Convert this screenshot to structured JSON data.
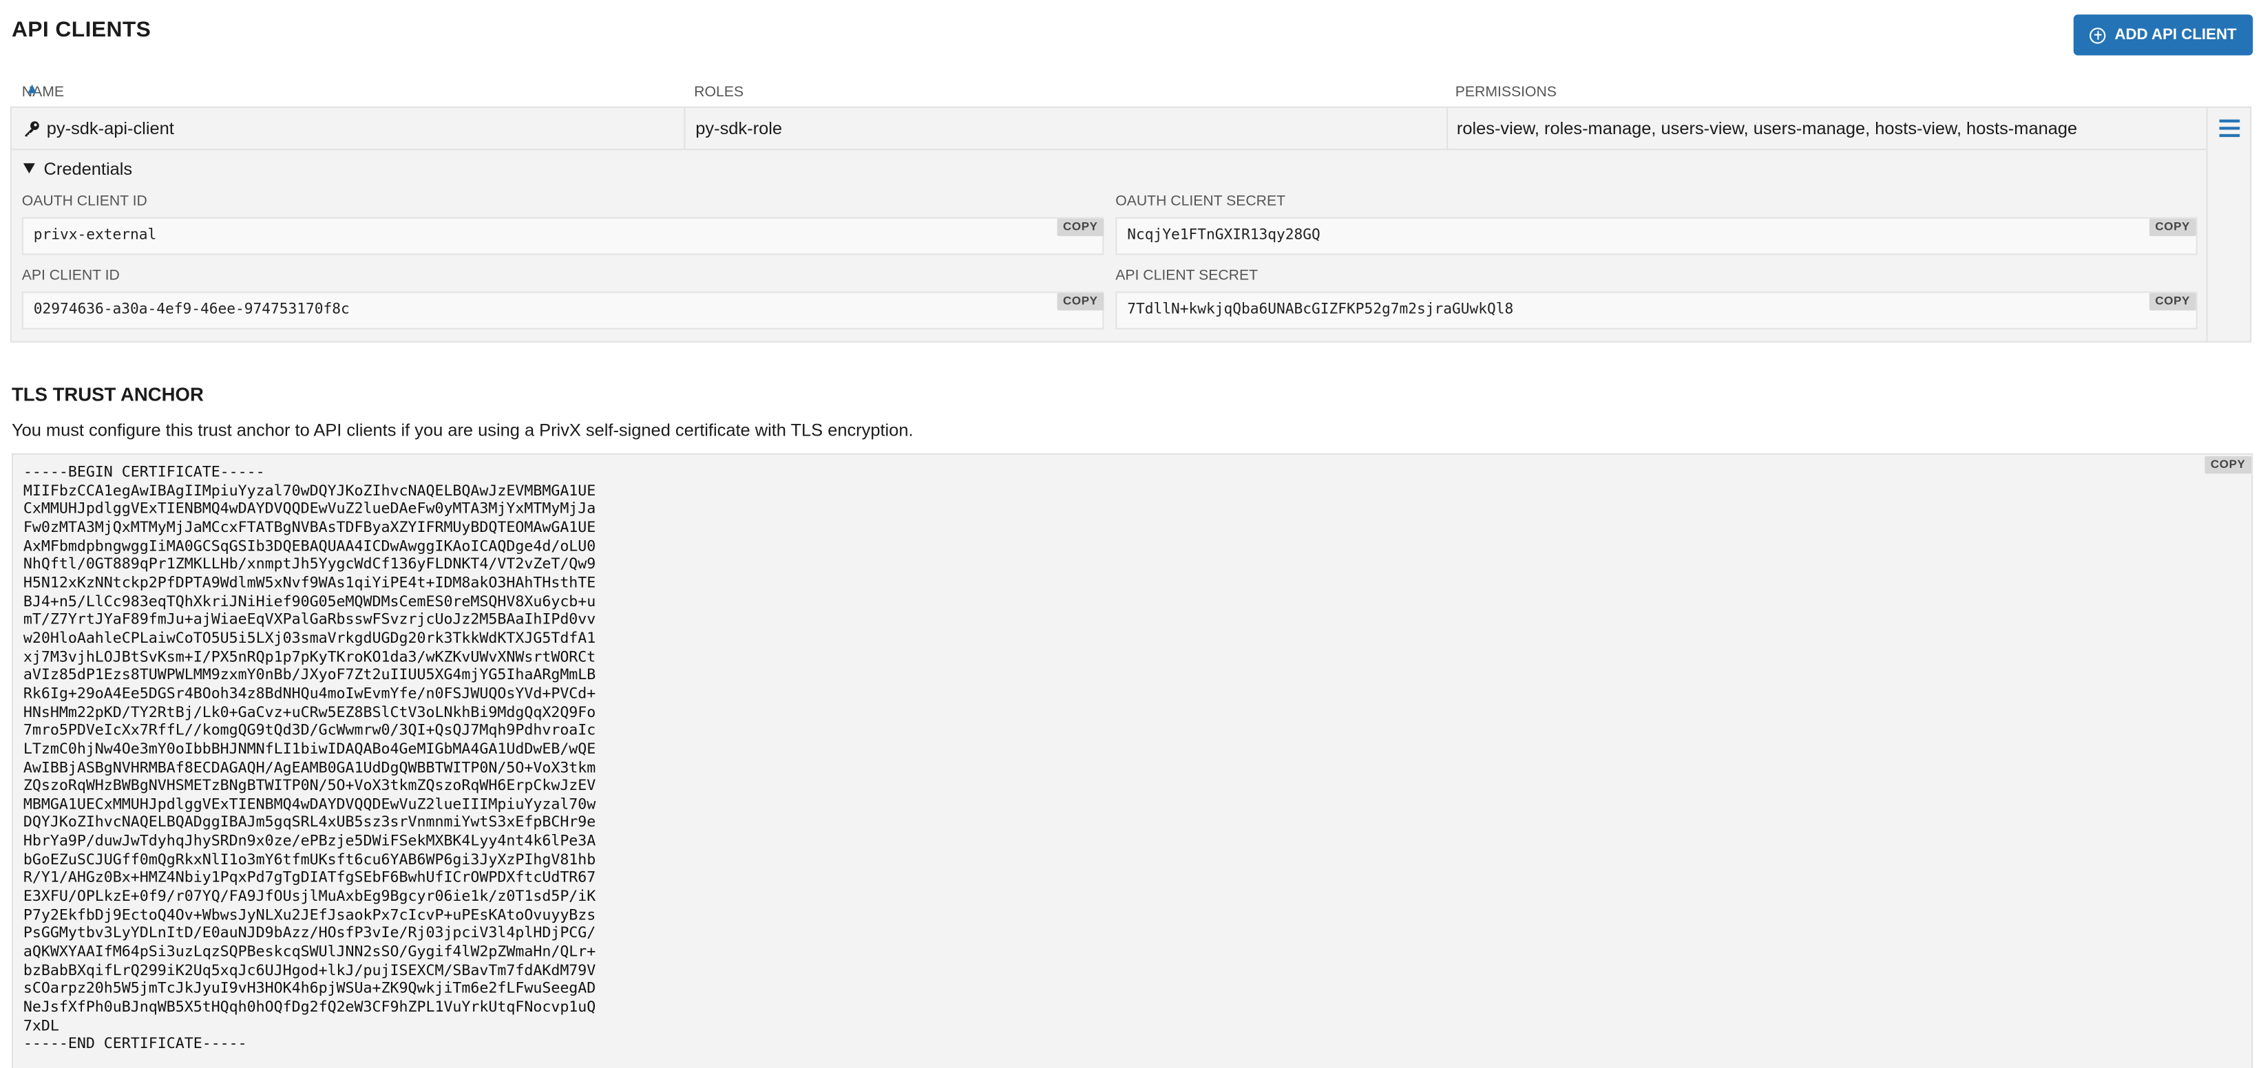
{
  "header": {
    "title": "API CLIENTS",
    "add_button_label": "ADD API CLIENT"
  },
  "table": {
    "columns": [
      "NAME",
      "ROLES",
      "PERMISSIONS"
    ],
    "rows": [
      {
        "name": "py-sdk-api-client",
        "roles": "py-sdk-role",
        "permissions": "roles-view, roles-manage, users-view, users-manage, hosts-view, hosts-manage"
      }
    ]
  },
  "credentials": {
    "toggle_label": "Credentials",
    "oauth_client_id_label": "OAUTH CLIENT ID",
    "oauth_client_id": "privx-external",
    "oauth_client_secret_label": "OAUTH CLIENT SECRET",
    "oauth_client_secret": "NcqjYe1FTnGXIR13qy28GQ",
    "api_client_id_label": "API CLIENT ID",
    "api_client_id": "02974636-a30a-4ef9-46ee-974753170f8c",
    "api_client_secret_label": "API CLIENT SECRET",
    "api_client_secret": "7TdllN+kwkjqQba6UNABcGIZFKP52g7m2sjraGUwkQl8",
    "copy_label": "COPY"
  },
  "trust_anchor": {
    "title": "TLS TRUST ANCHOR",
    "description": "You must configure this trust anchor to API clients if you are using a PrivX self-signed certificate with TLS encryption.",
    "copy_label": "COPY",
    "certificate": "-----BEGIN CERTIFICATE-----\nMIIFbzCCA1egAwIBAgIIMpiuYyzal70wDQYJKoZIhvcNAQELBQAwJzEVMBMGA1UE\nCxMMUHJpdlggVExTIENBMQ4wDAYDVQQDEwVuZ2lueDAeFw0yMTA3MjYxMTMyMjJa\nFw0zMTA3MjQxMTMyMjJaMCcxFTATBgNVBAsTDFByaXZYIFRMUyBDQTEOMAwGA1UE\nAxMFbmdpbngwggIiMA0GCSqGSIb3DQEBAQUAA4ICDwAwggIKAoICAQDge4d/oLU0\nNhQftl/0GT889qPr1ZMKLLHb/xnmptJh5YygcWdCf136yFLDNKT4/VT2vZeT/Qw9\nH5N12xKzNNtckp2PfDPTA9WdlmW5xNvf9WAs1qiYiPE4t+IDM8akO3HAhTHsthTE\nBJ4+n5/LlCc983eqTQhXkriJNiHief90G05eMQWDMsCemES0reMSQHV8Xu6ycb+u\nmT/Z7YrtJYaF89fmJu+ajWiaeEqVXPalGaRbsswFSvzrjcUoJz2M5BAaIhIPd0vv\nw20HloAahleCPLaiwCoTO5U5i5LXj03smaVrkgdUGDg20rk3TkkWdKTXJG5TdfA1\nxj7M3vjhLOJBtSvKsm+I/PX5nRQp1p7pKyTKroKO1da3/wKZKvUWvXNWsrtWORCt\naVIz85dP1Ezs8TUWPWLMM9zxmY0nBb/JXyoF7Zt2uIIUU5XG4mjYG5IhaARgMmLB\nRk6Ig+29oA4Ee5DGSr4BOoh34z8BdNHQu4moIwEvmYfe/n0FSJWUQOsYVd+PVCd+\nHNsHMm22pKD/TY2RtBj/Lk0+GaCvz+uCRw5EZ8BSlCtV3oLNkhBi9MdgQqX2Q9Fo\n7mro5PDVeIcXx7RffL//komgQG9tQd3D/GcWwmrw0/3QI+QsQJ7Mqh9PdhvroaIc\nLTzmC0hjNw4Oe3mY0oIbbBHJNMNfLI1biwIDAQABo4GeMIGbMA4GA1UdDwEB/wQE\nAwIBBjASBgNVHRMBAf8ECDAGAQH/AgEAMB0GA1UdDgQWBBTWITP0N/5O+VoX3tkm\nZQszoRqWHzBWBgNVHSMETzBNgBTWITP0N/5O+VoX3tkmZQszoRqWH6ErpCkwJzEV\nMBMGA1UECxMMUHJpdlggVExTIENBMQ4wDAYDVQQDEwVuZ2lueIIIMpiuYyzal70w\nDQYJKoZIhvcNAQELBQADggIBAJm5gqSRL4xUB5sz3srVnmnmiYwtS3xEfpBCHr9e\nHbrYa9P/duwJwTdyhqJhySRDn9x0ze/ePBzje5DWiFSekMXBK4Lyy4nt4k6lPe3A\nbGoEZuSCJUGff0mQgRkxNlI1o3mY6tfmUKsft6cu6YAB6WP6gi3JyXzPIhgV81hb\nR/Y1/AHGz0Bx+HMZ4Nbiy1PqxPd7gTgDIATfgSEbF6BwhUfICrOWPDXftcUdTR67\nE3XFU/OPLkzE+0f9/r07YQ/FA9JfOUsjlMuAxbEg9Bgcyr06ie1k/z0T1sd5P/iK\nP7y2EkfbDj9EctoQ4Ov+WbwsJyNLXu2JEfJsaokPx7cIcvP+uPEsKAtoOvuyyBzs\nPsGGMytbv3LyYDLnItD/E0auNJD9bAzz/HOsfP3vIe/Rj03jpciV3l4plHDjPCG/\naQKWXYAAIfM64pSi3uzLqzSQPBeskcqSWUlJNN2sSO/Gygif4lW2pZWmaHn/QLr+\nbzBabBXqifLrQ299iK2Uq5xqJc6UJHgod+lkJ/pujISEXCM/SBavTm7fdAKdM79V\nsCOarpz20h5W5jmTcJkJyuI9vH3HOK4h6pjWSUa+ZK9QwkjiTm6e2fLFwuSeegAD\nNeJsfXfPh0uBJnqWB5X5tHQqh0hOQfDg2fQ2eW3CF9hZPL1VuYrkUtqFNocvp1uQ\n7xDL\n-----END CERTIFICATE-----"
  }
}
